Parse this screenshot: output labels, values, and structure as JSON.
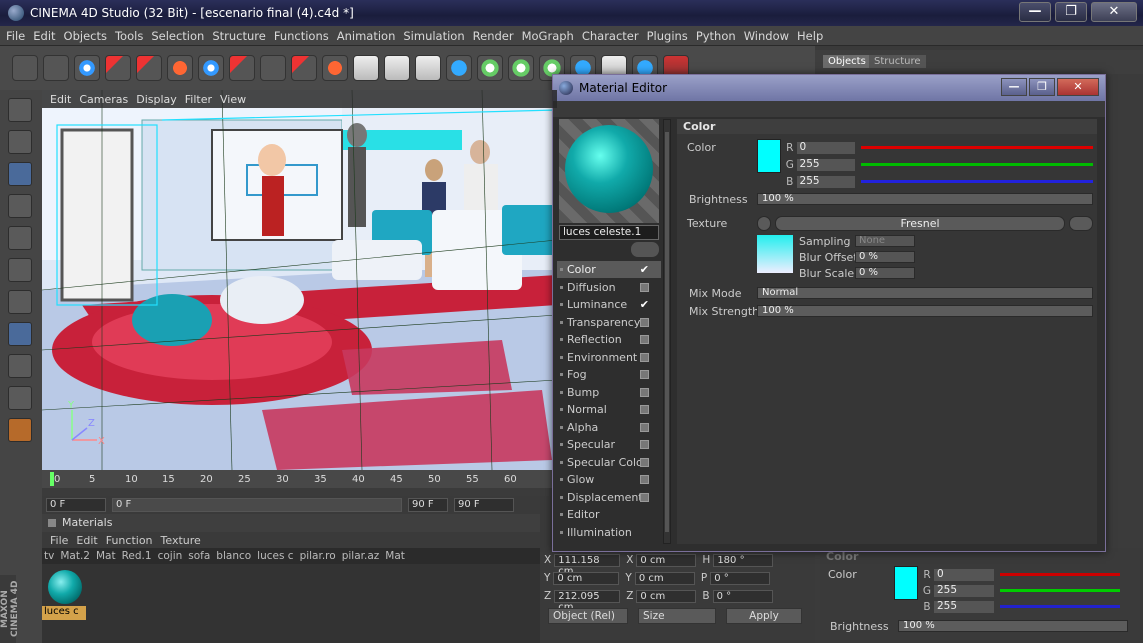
{
  "app": {
    "title": "CINEMA 4D Studio (32 Bit) - [escenario final (4).c4d *]",
    "window_buttons": [
      "—",
      "❐",
      "✕"
    ]
  },
  "menu": [
    "File",
    "Edit",
    "Objects",
    "Tools",
    "Selection",
    "Structure",
    "Functions",
    "Animation",
    "Simulation",
    "Render",
    "MoGraph",
    "Character",
    "Plugins",
    "Python",
    "Window",
    "Help"
  ],
  "object_tabs": {
    "objects": "Objects",
    "structure": "Structure"
  },
  "viewport": {
    "menu": [
      "Edit",
      "Cameras",
      "Display",
      "Filter",
      "View"
    ],
    "axis_labels": {
      "y": "Y",
      "z": "Z",
      "x": "X"
    }
  },
  "timeline": {
    "ticks": [
      "0",
      "5",
      "10",
      "15",
      "20",
      "25",
      "30",
      "35",
      "40",
      "45",
      "50",
      "55",
      "60"
    ],
    "start_frame": "0 F",
    "current_frame": "0 F",
    "end_frame_a": "90 F",
    "end_frame_b": "90 F"
  },
  "materials": {
    "title": "Materials",
    "menu": [
      "File",
      "Edit",
      "Function",
      "Texture"
    ],
    "list": [
      "tv",
      "Mat.2",
      "Mat",
      "Red.1",
      "cojin",
      "sofa",
      "blanco",
      "luces c",
      "pilar.ro",
      "pilar.az",
      "Mat"
    ],
    "selected_label": "luces c"
  },
  "brand": "MAXON CINEMA 4D",
  "coords": {
    "x_pos": "111.158 cm",
    "y_pos": "0 cm",
    "z_pos": "212.095 cm",
    "x_size": "0 cm",
    "y_size": "0 cm",
    "z_size": "0 cm",
    "h_rot": "180 °",
    "p_rot": "0 °",
    "b_rot": "0 °",
    "labels": {
      "x": "X",
      "y": "Y",
      "z": "Z",
      "h": "H",
      "p": "P",
      "b": "B"
    },
    "mode": "Object (Rel)",
    "size_mode": "Size",
    "apply": "Apply"
  },
  "material_editor": {
    "title": "Material Editor",
    "material_name": "luces celeste.1",
    "channels": [
      {
        "label": "Color",
        "checked": true,
        "active": true
      },
      {
        "label": "Diffusion",
        "checked": false
      },
      {
        "label": "Luminance",
        "checked": true
      },
      {
        "label": "Transparency",
        "checked": false
      },
      {
        "label": "Reflection",
        "checked": false
      },
      {
        "label": "Environment",
        "checked": false
      },
      {
        "label": "Fog",
        "checked": false
      },
      {
        "label": "Bump",
        "checked": false
      },
      {
        "label": "Normal",
        "checked": false
      },
      {
        "label": "Alpha",
        "checked": false
      },
      {
        "label": "Specular",
        "checked": false
      },
      {
        "label": "Specular Color",
        "checked": false
      },
      {
        "label": "Glow",
        "checked": false
      },
      {
        "label": "Displacement",
        "checked": false
      },
      {
        "label": "Editor",
        "checked": null
      },
      {
        "label": "Illumination",
        "checked": null
      }
    ],
    "section": "Color",
    "color_label": "Color",
    "color_hex": "#00ffff",
    "r": "0",
    "g": "255",
    "b": "255",
    "r_label": "R",
    "g_label": "G",
    "b_label": "B",
    "brightness_label": "Brightness",
    "brightness": "100 %",
    "texture_label": "Texture",
    "texture_value": "Fresnel",
    "sampling_label": "Sampling",
    "sampling_value": "None",
    "blur_offset_label": "Blur Offset",
    "blur_offset": "0 %",
    "blur_scale_label": "Blur Scale",
    "blur_scale": "0 %",
    "mix_mode_label": "Mix Mode",
    "mix_mode": "Normal",
    "mix_strength_label": "Mix Strength",
    "mix_strength": "100 %"
  },
  "attr_lower": {
    "section": "Color",
    "color_label": "Color",
    "r": "0",
    "g": "255",
    "b": "255",
    "brightness_label": "Brightness",
    "brightness": "100 %"
  }
}
